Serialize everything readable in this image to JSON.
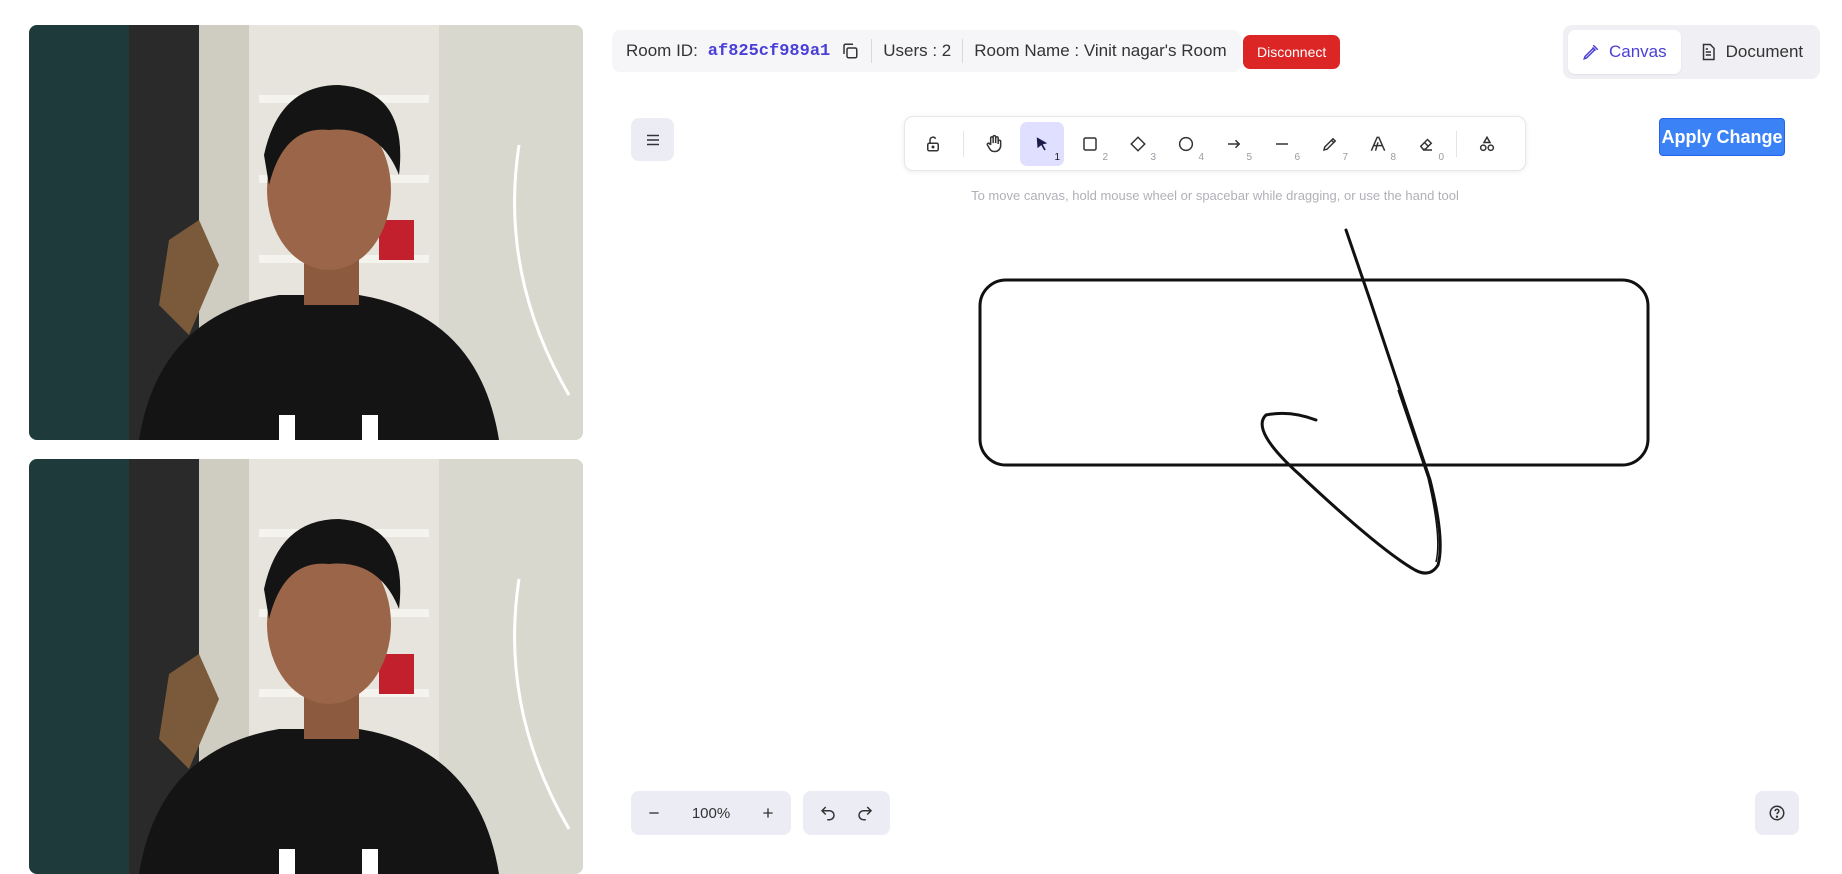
{
  "room": {
    "id_label": "Room ID:",
    "id_value": "af825cf989a1",
    "users": "Users : 2",
    "name": "Room Name : Vinit nagar's Room",
    "disconnect_label": "Disconnect"
  },
  "view_switch": {
    "canvas_label": "Canvas",
    "document_label": "Document",
    "active": "Canvas"
  },
  "toolbar": {
    "tools": [
      {
        "name": "lock",
        "key": ""
      },
      {
        "name": "hand",
        "key": ""
      },
      {
        "name": "selection",
        "key": "1",
        "active": true
      },
      {
        "name": "rectangle",
        "key": "2"
      },
      {
        "name": "diamond",
        "key": "3"
      },
      {
        "name": "ellipse",
        "key": "4"
      },
      {
        "name": "arrow",
        "key": "5"
      },
      {
        "name": "line",
        "key": "6"
      },
      {
        "name": "draw",
        "key": "7"
      },
      {
        "name": "text",
        "key": "8"
      },
      {
        "name": "eraser",
        "key": "0"
      },
      {
        "name": "more-shapes",
        "key": ""
      }
    ]
  },
  "hint": "To move canvas, hold mouse wheel or spacebar while dragging, or use the hand tool",
  "apply_label": "Apply Change",
  "zoom": {
    "level": "100%"
  },
  "colors": {
    "accent": "#4a3fd6",
    "danger": "#dc2626",
    "primary": "#3b82f6",
    "active_tool_bg": "#e0dfff"
  },
  "icons": [
    "copy-icon",
    "pen-icon",
    "document-icon",
    "hamburger-menu-icon",
    "minus-icon",
    "plus-icon",
    "undo-icon",
    "redo-icon",
    "help-icon"
  ]
}
